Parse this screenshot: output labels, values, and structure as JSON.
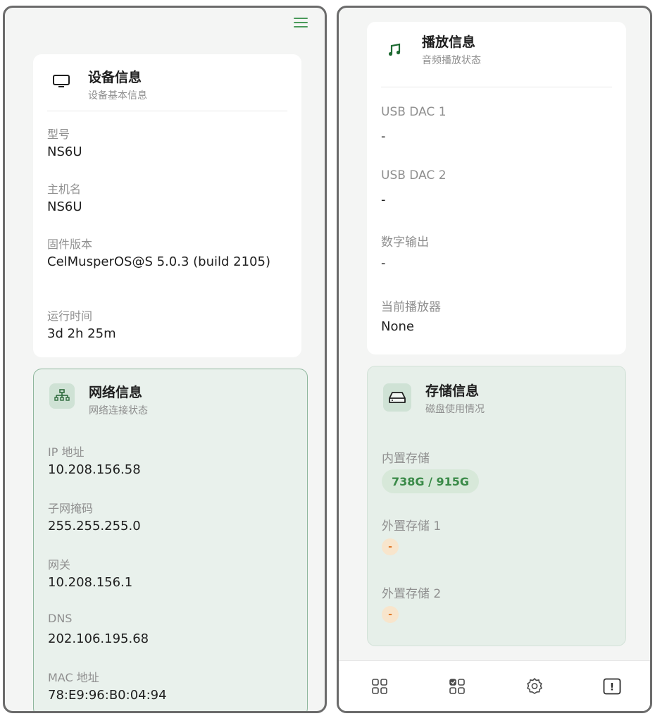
{
  "left": {
    "device": {
      "title": "设备信息",
      "subtitle": "设备基本信息",
      "fields": [
        {
          "label": "型号",
          "value": "NS6U"
        },
        {
          "label": "主机名",
          "value": "NS6U"
        },
        {
          "label": "固件版本",
          "value": "CelMusperOS@S 5.0.3 (build 2105)"
        },
        {
          "label": "运行时间",
          "value": "3d 2h 25m"
        }
      ]
    },
    "network": {
      "title": "网络信息",
      "subtitle": "网络连接状态",
      "fields": [
        {
          "label": "IP 地址",
          "value": "10.208.156.58"
        },
        {
          "label": "子网掩码",
          "value": "255.255.255.0"
        },
        {
          "label": "网关",
          "value": "10.208.156.1"
        },
        {
          "label": "DNS",
          "value": "202.106.195.68"
        },
        {
          "label": "MAC 地址",
          "value": "78:E9:96:B0:04:94"
        }
      ]
    }
  },
  "right": {
    "playback": {
      "title": "播放信息",
      "subtitle": "音频播放状态",
      "fields": [
        {
          "label": "USB DAC 1",
          "value": "-"
        },
        {
          "label": "USB DAC 2",
          "value": "-"
        },
        {
          "label": "数字输出",
          "value": "-"
        },
        {
          "label": "当前播放器",
          "value": "None"
        }
      ]
    },
    "storage": {
      "title": "存储信息",
      "subtitle": "磁盘使用情况",
      "fields": [
        {
          "label": "内置存储",
          "value": "738G / 915G"
        },
        {
          "label": "外置存储 1",
          "value": "-"
        },
        {
          "label": "外置存储 2",
          "value": "-"
        }
      ]
    }
  },
  "nav": {
    "items": [
      "dashboard-icon",
      "apps-icon",
      "settings-icon",
      "alert-icon"
    ],
    "alert_glyph": "!"
  },
  "colors": {
    "accent": "#4a9a5a",
    "pill_bg": "#d7e8d9",
    "pill_text": "#3a8a48",
    "warn_bg": "#f8e5cc",
    "warn_text": "#e07a2a"
  }
}
